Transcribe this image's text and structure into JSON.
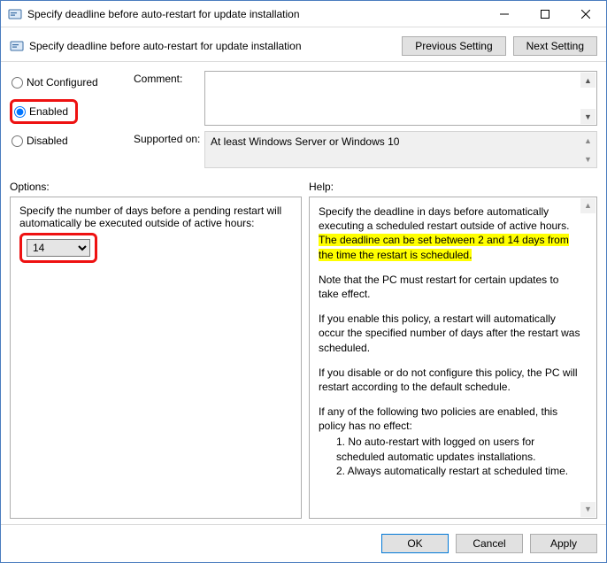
{
  "window": {
    "title": "Specify deadline before auto-restart for update installation"
  },
  "toolbar": {
    "title": "Specify deadline before auto-restart for update installation",
    "prev": "Previous Setting",
    "next": "Next Setting"
  },
  "radios": {
    "not_configured": "Not Configured",
    "enabled": "Enabled",
    "disabled": "Disabled"
  },
  "labels": {
    "comment": "Comment:",
    "supported": "Supported on:",
    "options": "Options:",
    "help": "Help:"
  },
  "supported_text": "At least Windows Server or Windows 10",
  "options": {
    "desc": "Specify the number of days before a pending restart will automatically be executed outside of active hours:",
    "selected": "14"
  },
  "help": {
    "p1a": "Specify the deadline in days before automatically executing a scheduled restart outside of active hours. ",
    "p1b": "The deadline can be set between 2 and 14 days from the time the restart is scheduled.",
    "p2": "Note that the PC must restart for certain updates to take effect.",
    "p3": "If you enable this policy, a restart will automatically occur the specified number of days after the restart was scheduled.",
    "p4": "If you disable or do not configure this policy, the PC will restart according to the default schedule.",
    "p5": "If any of the following two policies are enabled, this policy has no effect:",
    "li1": "1. No auto-restart with logged on users for scheduled automatic updates installations.",
    "li2": "2. Always automatically restart at scheduled time."
  },
  "buttons": {
    "ok": "OK",
    "cancel": "Cancel",
    "apply": "Apply"
  }
}
